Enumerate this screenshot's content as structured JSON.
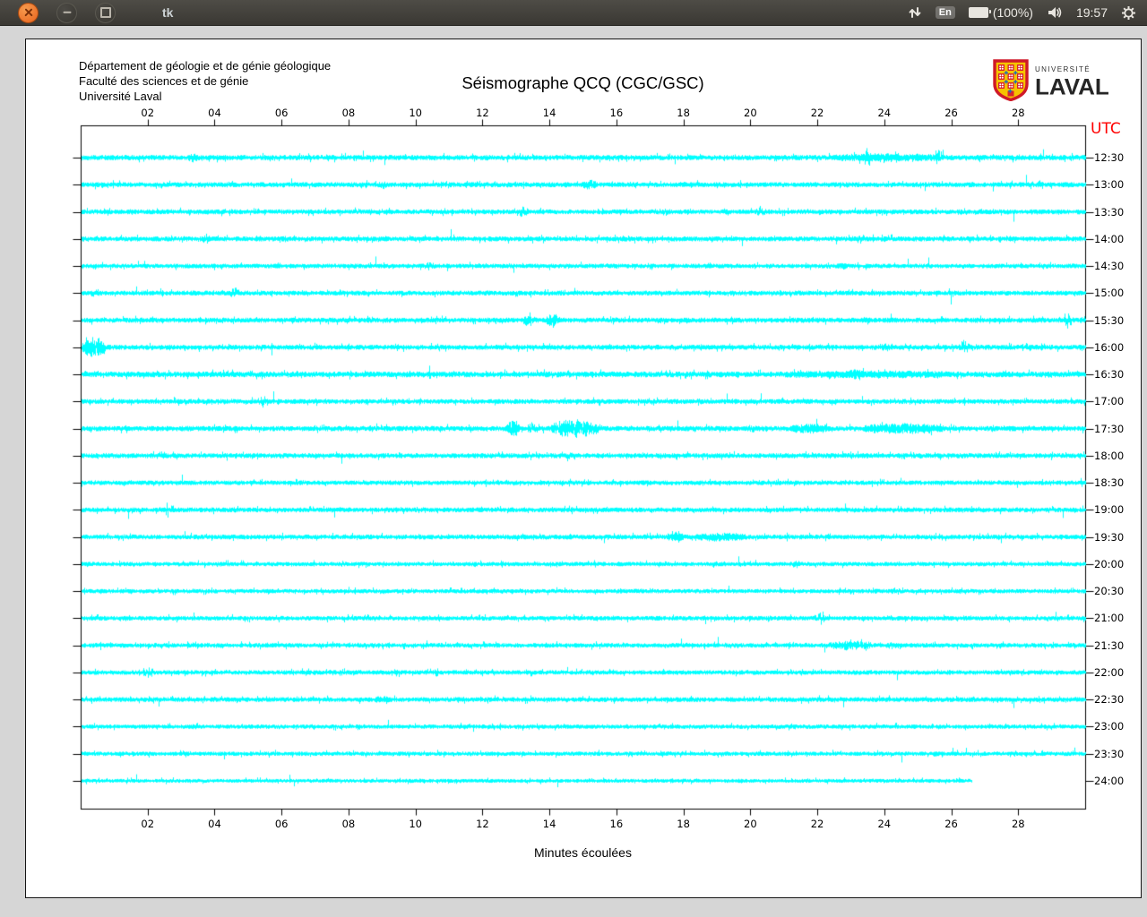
{
  "titlebar": {
    "title": "tk",
    "keyboard_layout": "En",
    "battery_label": "(100%)",
    "clock": "19:57"
  },
  "window": {
    "header": {
      "line1": "Département de géologie et de génie géologique",
      "line2": "Faculté des sciences et de génie",
      "line3": "Université Laval"
    },
    "logo": {
      "small": "UNIVERSITÉ",
      "large": "LAVAL"
    }
  },
  "chart_data": {
    "type": "line",
    "subtype": "helicorder-seismogram",
    "title": "Séismographe QCQ (CGC/GSC)",
    "xlabel": "Minutes écoulées",
    "right_axis_label": "UTC",
    "right_axis_color": "#ff0000",
    "trace_color": "#00ffff",
    "frame_color": "#000000",
    "x_range": [
      0,
      30
    ],
    "x_tick_labels": [
      "02",
      "04",
      "06",
      "08",
      "10",
      "12",
      "14",
      "16",
      "18",
      "20",
      "22",
      "24",
      "26",
      "28"
    ],
    "row_interval_minutes": 30,
    "traces": [
      {
        "utc": "12:30",
        "base": 2.3,
        "events": [
          [
            3.3,
            3.4,
            4
          ],
          [
            22.4,
            25.8,
            2.5
          ],
          [
            23.45,
            23.55,
            9
          ],
          [
            25.55,
            25.65,
            8
          ]
        ]
      },
      {
        "utc": "13:00",
        "base": 2.2,
        "events": [
          [
            9.0,
            9.1,
            3
          ],
          [
            15.0,
            15.4,
            4
          ]
        ]
      },
      {
        "utc": "13:30",
        "base": 2.1,
        "events": [
          [
            13.15,
            13.3,
            6
          ],
          [
            17.4,
            17.5,
            3
          ],
          [
            20.25,
            20.35,
            5
          ]
        ]
      },
      {
        "utc": "14:00",
        "base": 2.2,
        "events": [
          [
            3.65,
            3.8,
            5
          ],
          [
            23.2,
            23.3,
            3
          ]
        ]
      },
      {
        "utc": "14:30",
        "base": 2.0,
        "events": [
          [
            10.35,
            10.45,
            4
          ],
          [
            22.6,
            22.9,
            2
          ]
        ]
      },
      {
        "utc": "15:00",
        "base": 2.1,
        "events": [
          [
            0.3,
            0.5,
            3
          ],
          [
            4.55,
            4.65,
            6
          ]
        ]
      },
      {
        "utc": "15:30",
        "base": 2.2,
        "events": [
          [
            13.2,
            13.5,
            6
          ],
          [
            13.9,
            14.3,
            6
          ],
          [
            23.4,
            23.5,
            3
          ],
          [
            29.4,
            29.55,
            9
          ]
        ]
      },
      {
        "utc": "16:00",
        "base": 2.2,
        "events": [
          [
            0.0,
            0.75,
            11
          ],
          [
            24.0,
            24.1,
            3
          ],
          [
            26.3,
            26.45,
            8
          ],
          [
            28.2,
            28.3,
            6
          ]
        ]
      },
      {
        "utc": "16:30",
        "base": 2.5,
        "events": [
          [
            21.0,
            26.0,
            2
          ],
          [
            23.0,
            23.3,
            3
          ]
        ]
      },
      {
        "utc": "17:00",
        "base": 2.1,
        "events": [
          [
            5.35,
            5.5,
            6
          ]
        ]
      },
      {
        "utc": "17:30",
        "base": 2.3,
        "events": [
          [
            12.7,
            13.1,
            8
          ],
          [
            13.4,
            13.6,
            7
          ],
          [
            14.0,
            15.5,
            9
          ],
          [
            20.0,
            20.1,
            3
          ],
          [
            21.2,
            22.3,
            4
          ],
          [
            23.3,
            25.8,
            4
          ]
        ]
      },
      {
        "utc": "18:00",
        "base": 2.2,
        "events": [
          [
            14.5,
            14.7,
            3
          ]
        ]
      },
      {
        "utc": "18:30",
        "base": 2.0,
        "events": []
      },
      {
        "utc": "19:00",
        "base": 2.1,
        "events": [
          [
            2.55,
            2.7,
            9
          ]
        ]
      },
      {
        "utc": "19:30",
        "base": 2.1,
        "events": [
          [
            17.5,
            18.0,
            5
          ],
          [
            18.3,
            19.9,
            3
          ]
        ]
      },
      {
        "utc": "20:00",
        "base": 1.9,
        "events": [
          [
            21.3,
            21.4,
            3
          ]
        ]
      },
      {
        "utc": "20:30",
        "base": 1.9,
        "events": []
      },
      {
        "utc": "21:00",
        "base": 2.0,
        "events": [
          [
            22.05,
            22.15,
            7
          ]
        ]
      },
      {
        "utc": "21:30",
        "base": 2.0,
        "events": [
          [
            22.3,
            23.6,
            4
          ],
          [
            24.1,
            24.3,
            3
          ]
        ]
      },
      {
        "utc": "22:00",
        "base": 2.0,
        "events": [
          [
            1.95,
            2.1,
            5
          ]
        ]
      },
      {
        "utc": "22:30",
        "base": 2.1,
        "events": [
          [
            8.8,
            9.3,
            3
          ]
        ]
      },
      {
        "utc": "23:00",
        "base": 1.9,
        "events": []
      },
      {
        "utc": "23:30",
        "base": 1.9,
        "events": []
      },
      {
        "utc": "24:00",
        "base": 1.7,
        "end_min": 26.6,
        "events": []
      }
    ]
  }
}
